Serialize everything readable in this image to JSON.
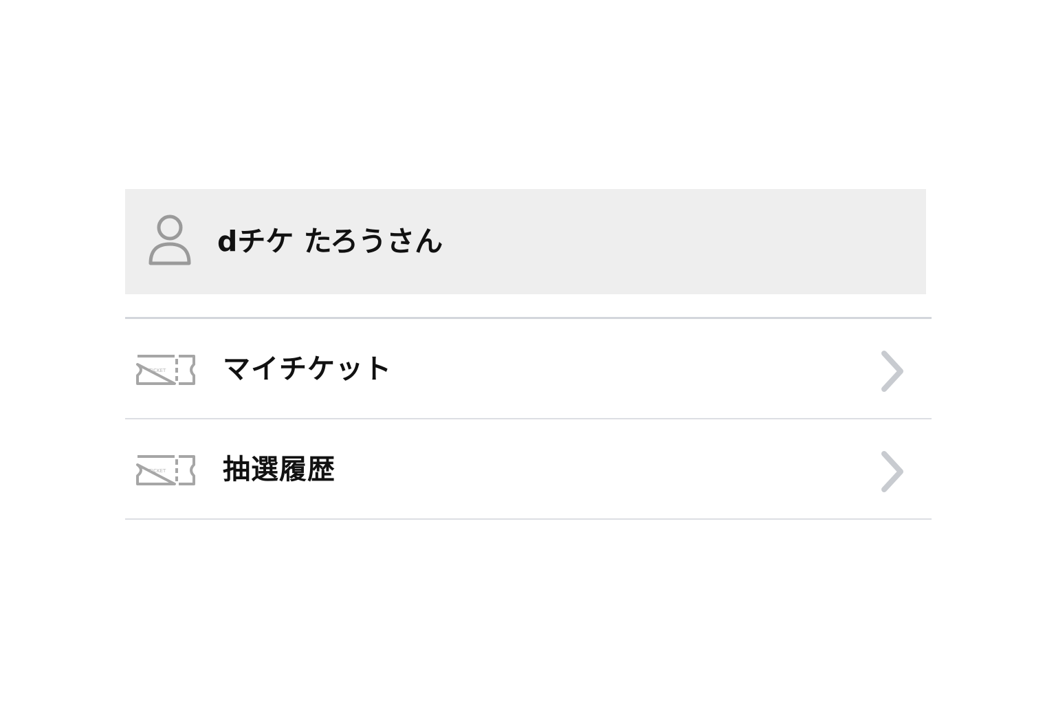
{
  "user": {
    "name": "dチケ たろうさん",
    "icon": "user-icon"
  },
  "menu": {
    "items": [
      {
        "label": "マイチケット",
        "icon": "ticket-icon"
      },
      {
        "label": "抽選履歴",
        "icon": "ticket-icon"
      }
    ],
    "chevron_icon": "chevron-right-icon"
  },
  "colors": {
    "header_bg": "#eeeeee",
    "divider": "#d3d6dc",
    "icon_gray": "#9a9a9a",
    "chevron_gray": "#c8cbd0",
    "text": "#111111"
  }
}
